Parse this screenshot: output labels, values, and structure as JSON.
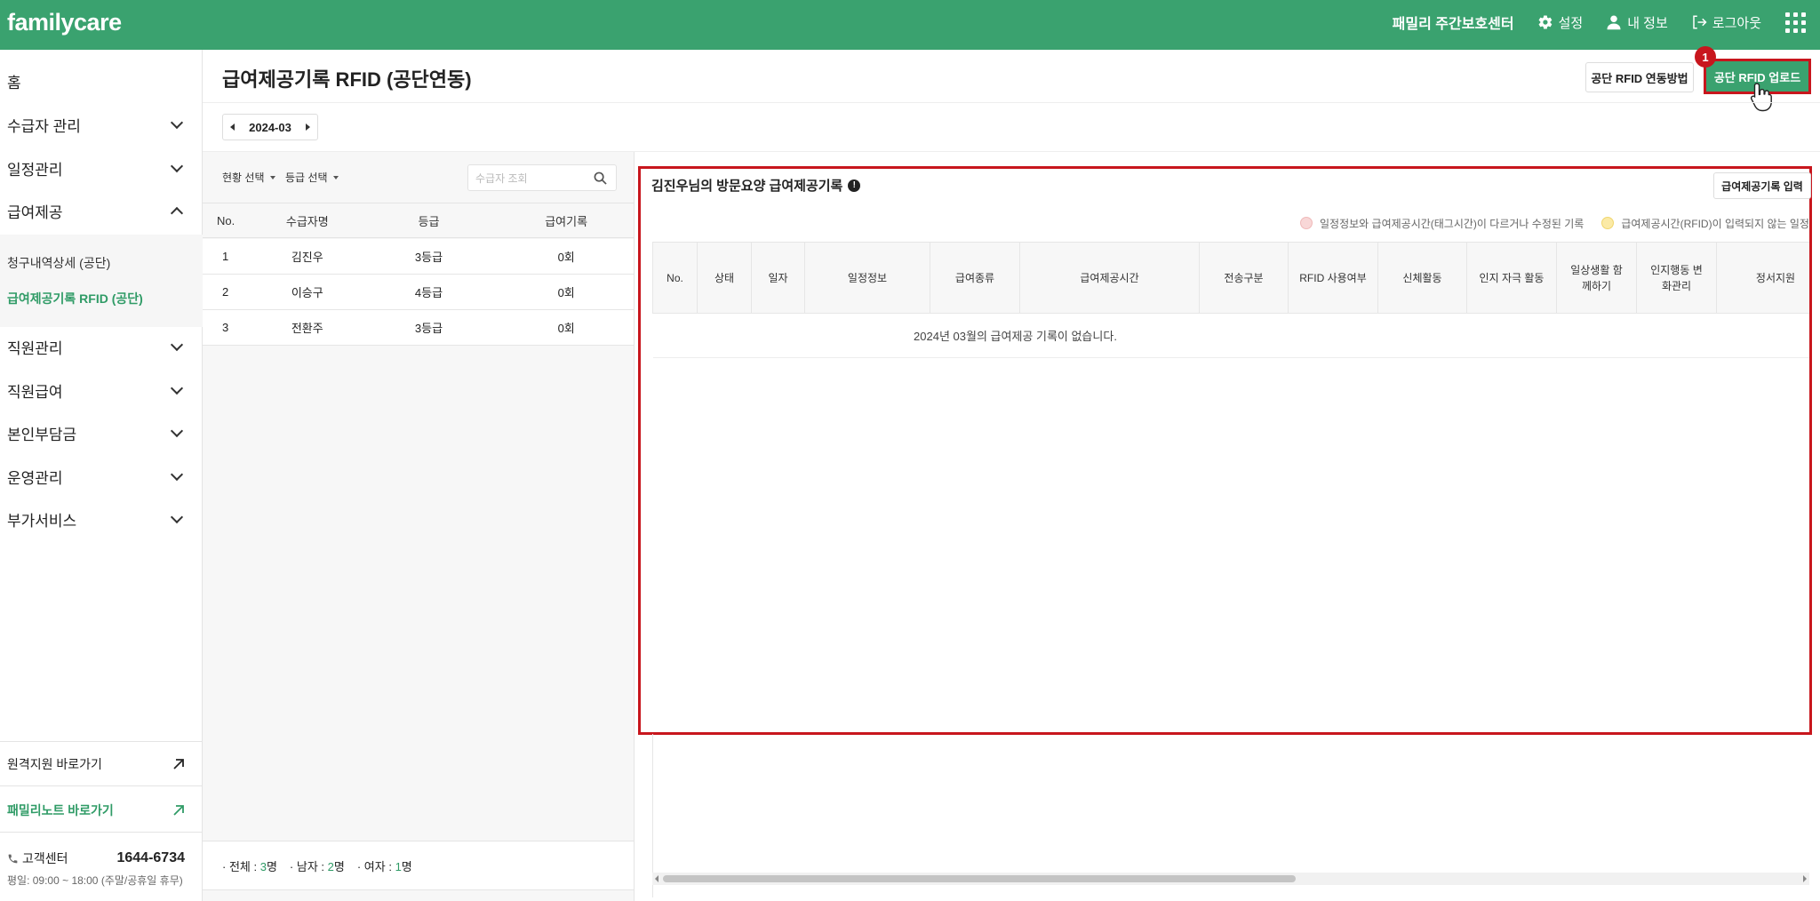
{
  "app": {
    "logo": "familycare",
    "center_name": "패밀리 주간보호센터",
    "settings": "설정",
    "my_info": "내 정보",
    "logout": "로그아웃"
  },
  "sidebar": {
    "items": [
      {
        "label": "홈"
      },
      {
        "label": "수급자 관리"
      },
      {
        "label": "일정관리"
      },
      {
        "label": "급여제공"
      },
      {
        "label": "직원관리"
      },
      {
        "label": "직원급여"
      },
      {
        "label": "본인부담금"
      },
      {
        "label": "운영관리"
      },
      {
        "label": "부가서비스"
      }
    ],
    "sub_items": [
      {
        "label": "청구내역상세 (공단)"
      },
      {
        "label": "급여제공기록 RFID (공단)"
      }
    ],
    "remote_support": "원격지원 바로가기",
    "family_note": "패밀리노트 바로가기",
    "customer_center_label": "고객센터",
    "customer_center_phone": "1644-6734",
    "customer_center_hours": "평일: 09:00 ~ 18:00 (주말/공휴일 휴무)"
  },
  "page": {
    "title": "급여제공기록 RFID (공단연동)",
    "btn_rfid_guide": "공단 RFID 연동방법",
    "btn_rfid_upload": "공단 RFID 업로드",
    "step_badge": "1",
    "month": "2024-03"
  },
  "list": {
    "filter_status": "현황 선택",
    "filter_grade": "등급 선택",
    "search_placeholder": "수급자 조회",
    "columns": [
      "No.",
      "수급자명",
      "등급",
      "급여기록"
    ],
    "rows": [
      {
        "no": "1",
        "name": "김진우",
        "grade": "3등급",
        "record": "0회"
      },
      {
        "no": "2",
        "name": "이승구",
        "grade": "4등급",
        "record": "0회"
      },
      {
        "no": "3",
        "name": "전환주",
        "grade": "3등급",
        "record": "0회"
      }
    ],
    "footer": {
      "total_label": "· 전체 :",
      "total_value": "3",
      "male_label": "· 남자 :",
      "male_value": "2",
      "female_label": "· 여자 :",
      "female_value": "1",
      "unit": "명"
    }
  },
  "record": {
    "title": "김진우님의 방문요양 급여제공기록",
    "btn_input": "급여제공기록 입력",
    "legend": [
      {
        "label": "일정정보와 급여제공시간(태그시간)이 다르거나 수정된 기록",
        "color": "#f8d7d7"
      },
      {
        "label": "급여제공시간(RFID)이 입력되지 않는 일정",
        "color": "#fbeaa6"
      }
    ],
    "columns": [
      "No.",
      "상태",
      "일자",
      "일정정보",
      "급여종류",
      "급여제공시간",
      "전송구분",
      "RFID 사용여부",
      "신체활동",
      "인지 자극 활동",
      "일상생활 함께하기",
      "인지행동 변화관리",
      "정서지원"
    ],
    "empty_message": "2024년 03월의 급여제공 기록이 없습니다."
  },
  "colors": {
    "brand": "#3aa26f",
    "highlight": "#c8161d"
  }
}
